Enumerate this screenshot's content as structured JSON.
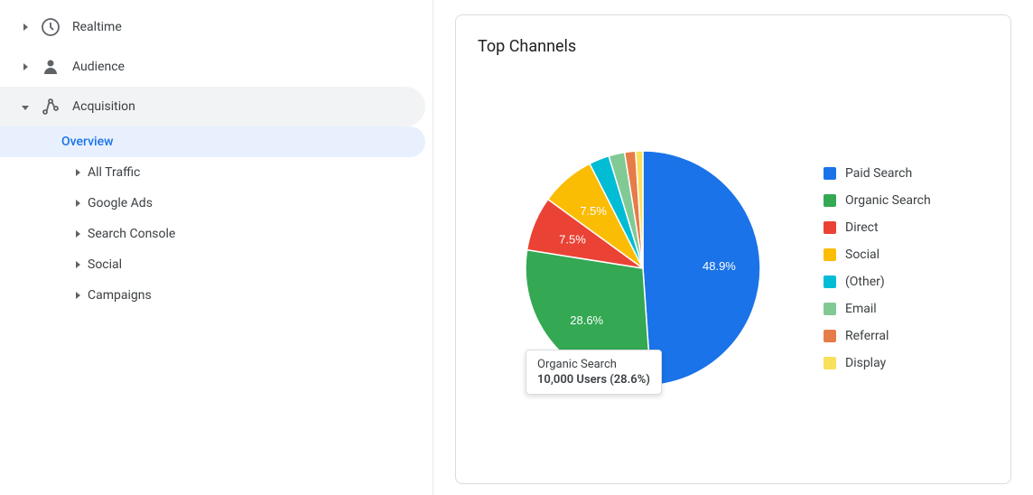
{
  "sidebar": {
    "items": [
      {
        "id": "realtime",
        "label": "Realtime",
        "icon": "clock",
        "arrow": "right",
        "level": 0
      },
      {
        "id": "audience",
        "label": "Audience",
        "icon": "person",
        "arrow": "right",
        "level": 0
      },
      {
        "id": "acquisition",
        "label": "Acquisition",
        "icon": "acquisition",
        "arrow": "down",
        "level": 0,
        "active": true
      }
    ],
    "sub_items": [
      {
        "id": "overview",
        "label": "Overview",
        "active": true
      },
      {
        "id": "all-traffic",
        "label": "All Traffic",
        "arrow": "right"
      },
      {
        "id": "google-ads",
        "label": "Google Ads",
        "arrow": "right"
      },
      {
        "id": "search-console",
        "label": "Search Console",
        "arrow": "right"
      },
      {
        "id": "social",
        "label": "Social",
        "arrow": "right"
      },
      {
        "id": "campaigns",
        "label": "Campaigns",
        "arrow": "right"
      }
    ]
  },
  "main": {
    "card_title": "Top Channels",
    "chart": {
      "segments": [
        {
          "id": "paid-search",
          "label": "Paid Search",
          "value": 48.9,
          "color": "#1a73e8"
        },
        {
          "id": "organic-search",
          "label": "Organic Search",
          "value": 28.6,
          "color": "#34a853"
        },
        {
          "id": "direct",
          "label": "Direct",
          "value": 7.5,
          "color": "#ea4335"
        },
        {
          "id": "social",
          "label": "Social",
          "value": 7.5,
          "color": "#fbbc04"
        },
        {
          "id": "other",
          "label": "(Other)",
          "value": 2.8,
          "color": "#00bcd4"
        },
        {
          "id": "email",
          "label": "Email",
          "value": 2.2,
          "color": "#81c995"
        },
        {
          "id": "referral",
          "label": "Referral",
          "value": 1.5,
          "color": "#e67c48"
        },
        {
          "id": "display",
          "label": "Display",
          "value": 1.0,
          "color": "#f9e05a"
        }
      ],
      "tooltip": {
        "title": "Organic Search",
        "value": "10,000 Users (28.6%)"
      }
    }
  }
}
